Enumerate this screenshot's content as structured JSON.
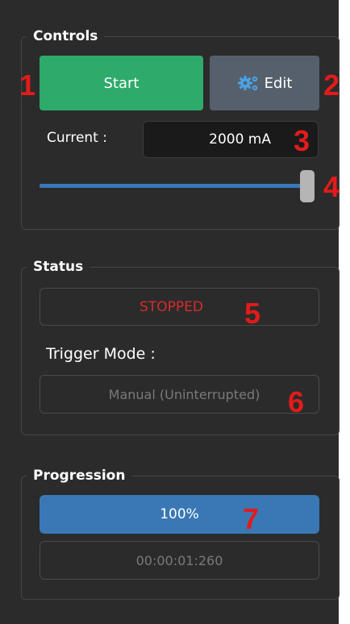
{
  "controls": {
    "legend": "Controls",
    "start_label": "Start",
    "edit_label": "Edit",
    "current_label": "Current :",
    "current_value": "2000 mA",
    "slider_level": 1.0
  },
  "status": {
    "legend": "Status",
    "state": "STOPPED",
    "trigger_label": "Trigger Mode :",
    "trigger_value": "Manual (Uninterrupted)"
  },
  "progression": {
    "legend": "Progression",
    "percent_text": "100%",
    "progress_fraction": 1.0,
    "elapsed": "00:00:01:260"
  },
  "callouts": [
    "1",
    "2",
    "3",
    "4",
    "5",
    "6",
    "7"
  ],
  "colors": {
    "start_green": "#2eaa6a",
    "edit_gray": "#55606c",
    "slider_blue": "#3a78b5",
    "progress_blue": "#3a78b5",
    "stopped_red": "#d92b2b",
    "callout_red": "#e31b1b"
  },
  "icons": {
    "edit": "gears-icon"
  }
}
